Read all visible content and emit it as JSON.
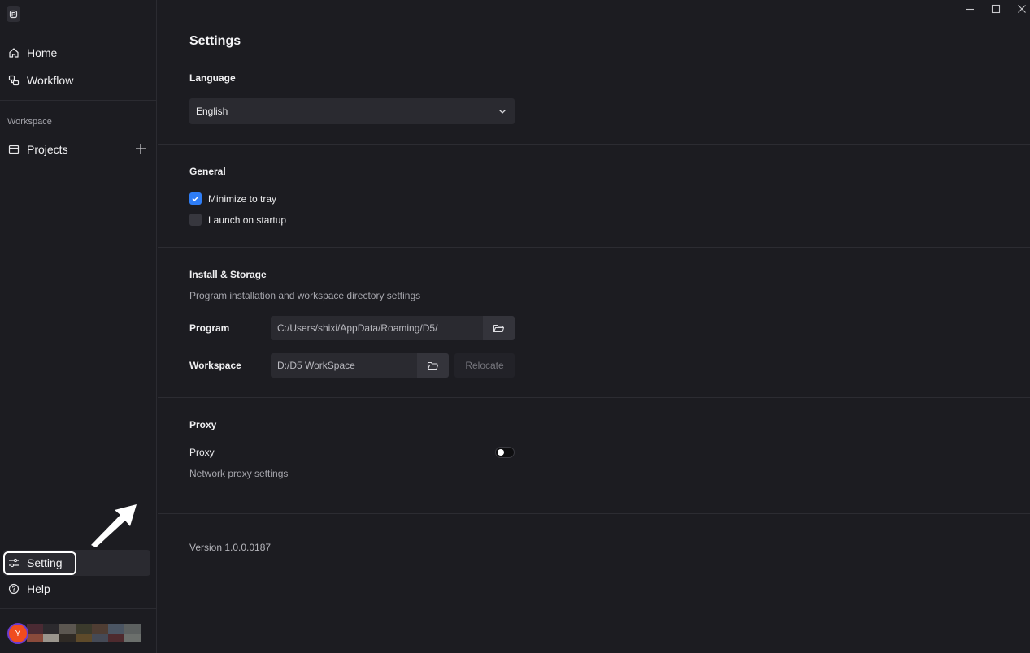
{
  "sidebar": {
    "home_label": "Home",
    "workflow_label": "Workflow",
    "workspace_section": "Workspace",
    "projects_label": "Projects",
    "setting_label": "Setting",
    "help_label": "Help",
    "avatar_initial": "Y"
  },
  "settings": {
    "title": "Settings",
    "language": {
      "title": "Language",
      "selected": "English"
    },
    "general": {
      "title": "General",
      "minimize_to_tray": {
        "label": "Minimize to tray",
        "checked": true
      },
      "launch_on_startup": {
        "label": "Launch on startup",
        "checked": false
      }
    },
    "storage": {
      "title": "Install & Storage",
      "description": "Program installation and workspace directory settings",
      "program_label": "Program",
      "program_path": "C:/Users/shixi/AppData/Roaming/D5/",
      "workspace_label": "Workspace",
      "workspace_path": "D:/D5 WorkSpace",
      "relocate_label": "Relocate"
    },
    "proxy": {
      "title": "Proxy",
      "label": "Proxy",
      "description": "Network proxy settings",
      "enabled": false
    },
    "version": "Version 1.0.0.0187"
  },
  "colors": {
    "background": "#1c1c21",
    "accent": "#2e7df6",
    "avatar": "#f04c1f"
  }
}
